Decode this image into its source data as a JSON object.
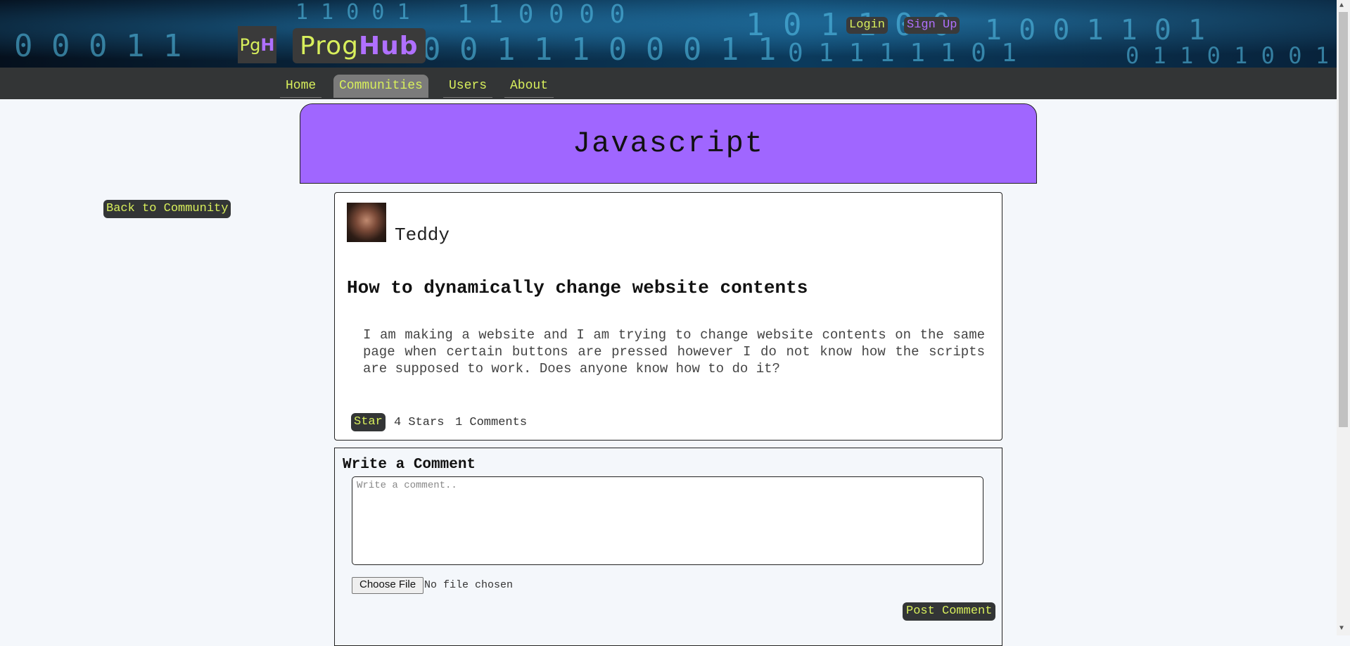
{
  "header": {
    "logo_prefix": "Pg",
    "logo_suffix": "H",
    "brand_prefix": "Prog",
    "brand_suffix": "Hub",
    "login_label": "Login",
    "signup_label": "Sign Up"
  },
  "nav": {
    "items": [
      {
        "label": "Home"
      },
      {
        "label": "Communities"
      },
      {
        "label": "Users"
      },
      {
        "label": "About"
      }
    ]
  },
  "community": {
    "title": "Javascript",
    "back_label": "Back to Community"
  },
  "post": {
    "author": "Teddy",
    "title": "How to dynamically change website contents",
    "body": "I am making a website and I am trying to change website contents on the same page when certain buttons are pressed however I do not know how the scripts are supposed to work. Does anyone know how to do it?",
    "star_label": "Star",
    "stars_text": "4 Stars",
    "comments_text": "1 Comments"
  },
  "comment_form": {
    "heading": "Write a Comment",
    "placeholder": "Write a comment..",
    "file_button": "Choose File",
    "file_status": "No file chosen",
    "submit_label": "Post Comment"
  },
  "colors": {
    "accent_green": "#d8ef5c",
    "accent_purple": "#b070ff",
    "community_banner": "#a066ff",
    "nav_bg": "#333536"
  }
}
